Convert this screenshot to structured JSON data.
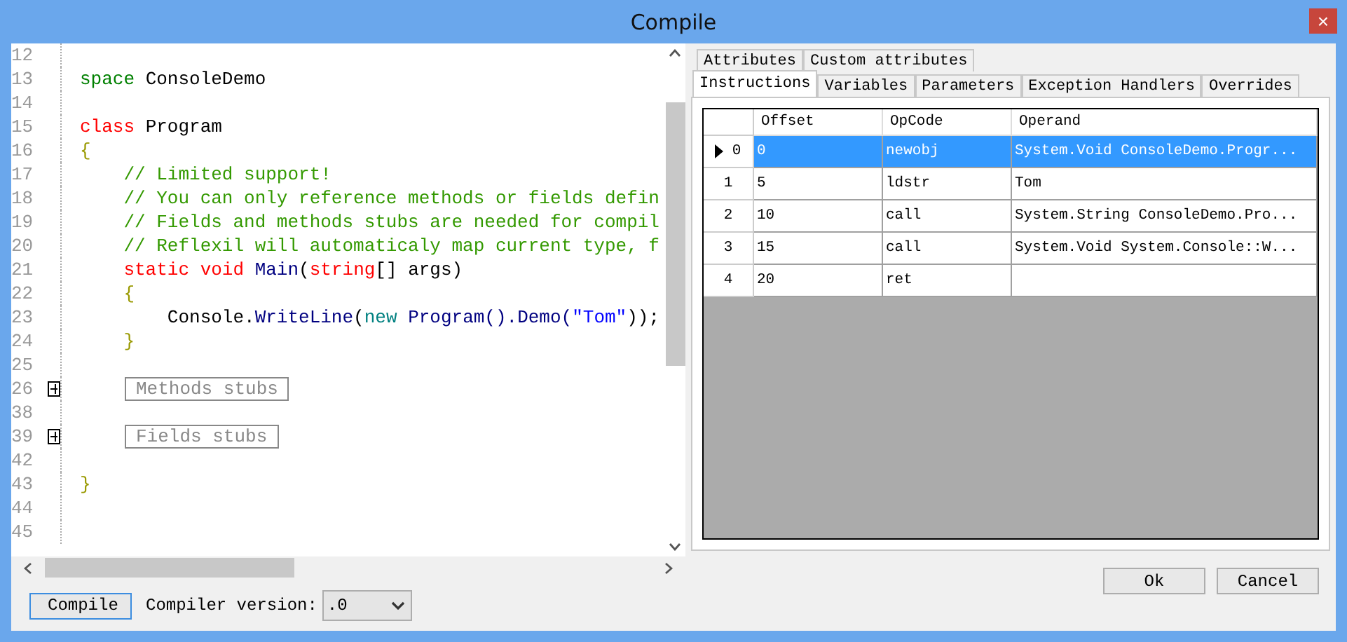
{
  "window": {
    "title": "Compile",
    "close": "×"
  },
  "editor": {
    "lines": [
      {
        "number": "12",
        "kind": "blank"
      },
      {
        "number": "13",
        "kind": "code",
        "tokens": [
          {
            "text": "space",
            "kind": "namespace"
          },
          {
            "text": " ConsoleDemo",
            "kind": "plain"
          }
        ]
      },
      {
        "number": "14",
        "kind": "blank"
      },
      {
        "number": "15",
        "kind": "code",
        "tokens": [
          {
            "text": "class",
            "kind": "keyword"
          },
          {
            "text": " Program",
            "kind": "plain"
          }
        ]
      },
      {
        "number": "16",
        "kind": "code",
        "tokens": [
          {
            "text": "{",
            "kind": "brace"
          }
        ]
      },
      {
        "number": "17",
        "kind": "code",
        "tokens": [
          {
            "text": "    // Limited support!",
            "kind": "comment"
          }
        ]
      },
      {
        "number": "18",
        "kind": "code",
        "tokens": [
          {
            "text": "    // You can only reference methods or fields defin",
            "kind": "comment"
          }
        ]
      },
      {
        "number": "19",
        "kind": "code",
        "tokens": [
          {
            "text": "    // Fields and methods stubs are needed for compil",
            "kind": "comment"
          }
        ]
      },
      {
        "number": "20",
        "kind": "code",
        "tokens": [
          {
            "text": "    // Reflexil will automaticaly map current type, f",
            "kind": "comment"
          }
        ]
      },
      {
        "number": "21",
        "kind": "code",
        "tokens": [
          {
            "text": "    static void",
            "kind": "keyword"
          },
          {
            "text": " Main",
            "kind": "member"
          },
          {
            "text": "(",
            "kind": "plain"
          },
          {
            "text": "string",
            "kind": "keyword"
          },
          {
            "text": "[] args)",
            "kind": "plain"
          }
        ]
      },
      {
        "number": "22",
        "kind": "code",
        "tokens": [
          {
            "text": "    {",
            "kind": "brace"
          }
        ]
      },
      {
        "number": "23",
        "kind": "code",
        "tokens": [
          {
            "text": "        Console.",
            "kind": "plain"
          },
          {
            "text": "WriteLine",
            "kind": "member"
          },
          {
            "text": "(",
            "kind": "plain"
          },
          {
            "text": "new",
            "kind": "new"
          },
          {
            "text": " Program().Demo(",
            "kind": "member"
          },
          {
            "text": "\"Tom\"",
            "kind": "string"
          },
          {
            "text": "));",
            "kind": "plain"
          }
        ]
      },
      {
        "number": "24",
        "kind": "code",
        "tokens": [
          {
            "text": "    }",
            "kind": "brace"
          }
        ]
      },
      {
        "number": "25",
        "kind": "blank"
      },
      {
        "number": "26",
        "kind": "fold",
        "label": "Methods stubs"
      },
      {
        "number": "38",
        "kind": "blank"
      },
      {
        "number": "39",
        "kind": "fold",
        "label": "Fields stubs"
      },
      {
        "number": "42",
        "kind": "blank"
      },
      {
        "number": "43",
        "kind": "code",
        "tokens": [
          {
            "text": "}",
            "kind": "brace"
          }
        ]
      },
      {
        "number": "44",
        "kind": "blank"
      },
      {
        "number": "45",
        "kind": "blank"
      }
    ]
  },
  "top_tabs": [
    {
      "label": "Attributes",
      "selected": false
    },
    {
      "label": "Custom attributes",
      "selected": false
    }
  ],
  "tabs": [
    {
      "label": "Instructions",
      "selected": true
    },
    {
      "label": "Variables",
      "selected": false
    },
    {
      "label": "Parameters",
      "selected": false
    },
    {
      "label": "Exception Handlers",
      "selected": false
    },
    {
      "label": "Overrides",
      "selected": false
    }
  ],
  "table": {
    "columns": [
      "Offset",
      "OpCode",
      "Operand"
    ],
    "rows": [
      {
        "index": "0",
        "selected": true,
        "cells": [
          "0",
          "newobj",
          "System.Void ConsoleDemo.Progr..."
        ]
      },
      {
        "index": "1",
        "selected": false,
        "cells": [
          "5",
          "ldstr",
          "Tom"
        ]
      },
      {
        "index": "2",
        "selected": false,
        "cells": [
          "10",
          "call",
          "System.String ConsoleDemo.Pro..."
        ]
      },
      {
        "index": "3",
        "selected": false,
        "cells": [
          "15",
          "call",
          "System.Void System.Console::W..."
        ]
      },
      {
        "index": "4",
        "selected": false,
        "cells": [
          "20",
          "ret",
          ""
        ]
      }
    ]
  },
  "compile_button": "Compile",
  "compiler_version": {
    "label": "Compiler version:",
    "value": ".0"
  },
  "buttons": [
    "Ok",
    "Cancel"
  ]
}
